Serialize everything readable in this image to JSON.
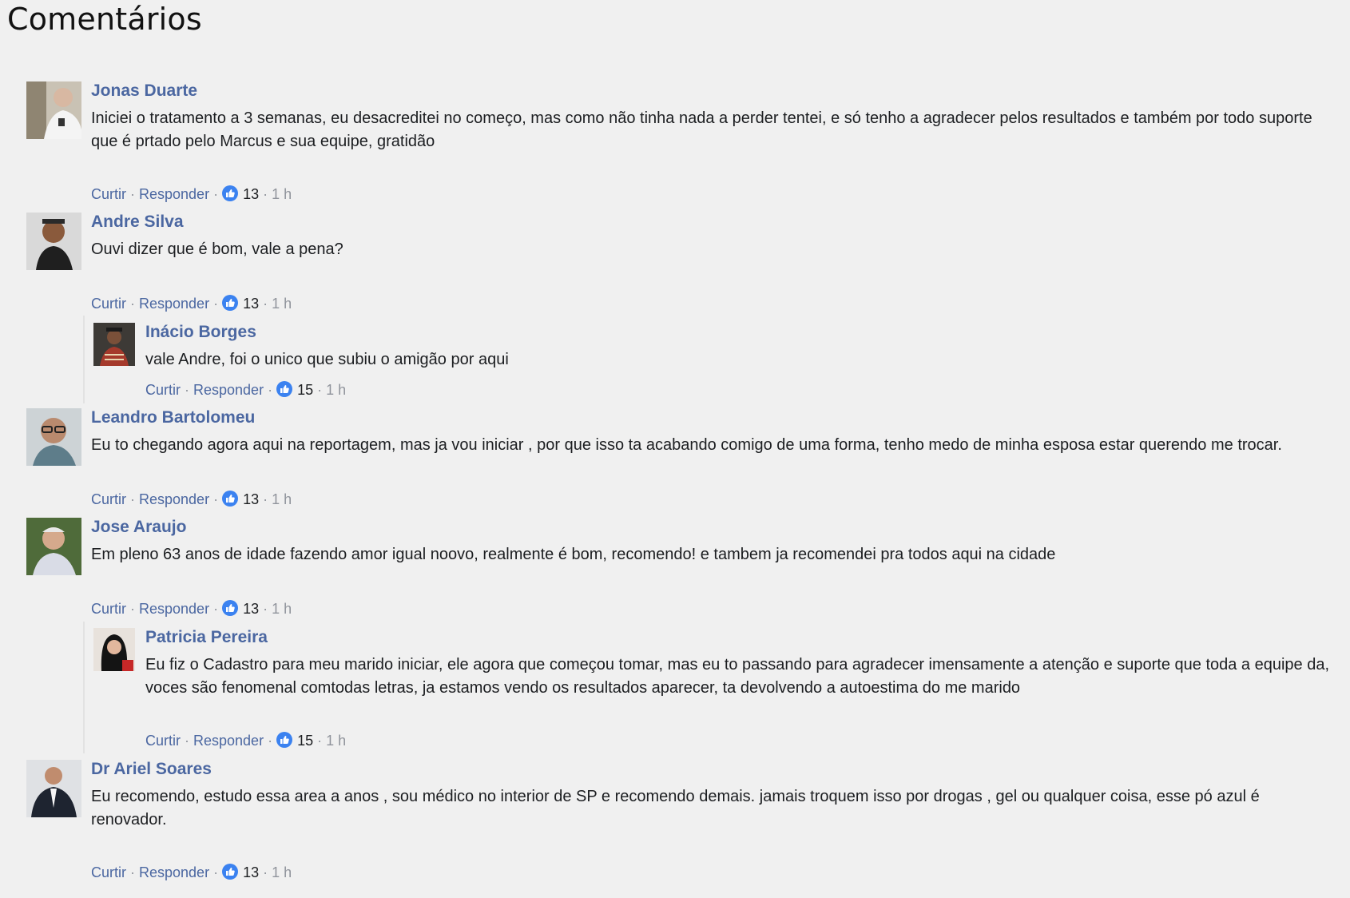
{
  "section_title": "Comentários",
  "actions": {
    "like": "Curtir",
    "reply": "Responder",
    "separator": "·"
  },
  "colors": {
    "name_link": "#4b67a1",
    "background": "#f0f0f0",
    "like_badge": "#3b82f0"
  },
  "comments": [
    {
      "name": "Jonas Duarte",
      "text": "Iniciei o tratamento a 3 semanas, eu desacreditei no começo, mas como não tinha nada a perder tentei, e só tenho a agradecer pelos resultados e também por todo suporte que é prtado pelo Marcus e sua equipe, gratidão",
      "likes": "13",
      "time": "1 h",
      "avatar_icon": "avatar-photo"
    },
    {
      "name": "Andre Silva",
      "text": "Ouvi dizer que é bom, vale a pena?",
      "likes": "13",
      "time": "1 h",
      "avatar_icon": "avatar-photo",
      "replies": [
        {
          "name": "Inácio Borges",
          "text": "vale Andre, foi o unico que subiu o amigão por aqui",
          "likes": "15",
          "time": "1 h",
          "avatar_icon": "avatar-photo"
        }
      ]
    },
    {
      "name": "Leandro Bartolomeu",
      "text": "Eu to chegando agora aqui na reportagem, mas ja vou iniciar , por que isso ta acabando comigo de uma forma, tenho medo de minha esposa estar querendo me trocar.",
      "likes": "13",
      "time": "1 h",
      "avatar_icon": "avatar-photo"
    },
    {
      "name": "Jose Araujo",
      "text": "Em pleno 63 anos de idade fazendo amor igual noovo, realmente é bom, recomendo! e tambem ja recomendei pra todos aqui na cidade",
      "likes": "13",
      "time": "1 h",
      "avatar_icon": "avatar-photo",
      "replies": [
        {
          "name": "Patricia Pereira",
          "text": "Eu fiz o Cadastro para meu marido iniciar, ele agora que começou tomar, mas eu to passando para agradecer imensamente a atenção e suporte que toda a equipe da, voces são fenomenal comtodas letras, ja estamos vendo os resultados aparecer, ta devolvendo a autoestima do me marido",
          "likes": "15",
          "time": "1 h",
          "avatar_icon": "avatar-photo"
        }
      ]
    },
    {
      "name": "Dr Ariel Soares",
      "text": "Eu recomendo, estudo essa area a anos , sou médico no interior de SP e recomendo demais. jamais troquem isso por drogas , gel ou qualquer coisa, esse pó azul é renovador.",
      "likes": "13",
      "time": "1 h",
      "avatar_icon": "avatar-photo"
    }
  ]
}
